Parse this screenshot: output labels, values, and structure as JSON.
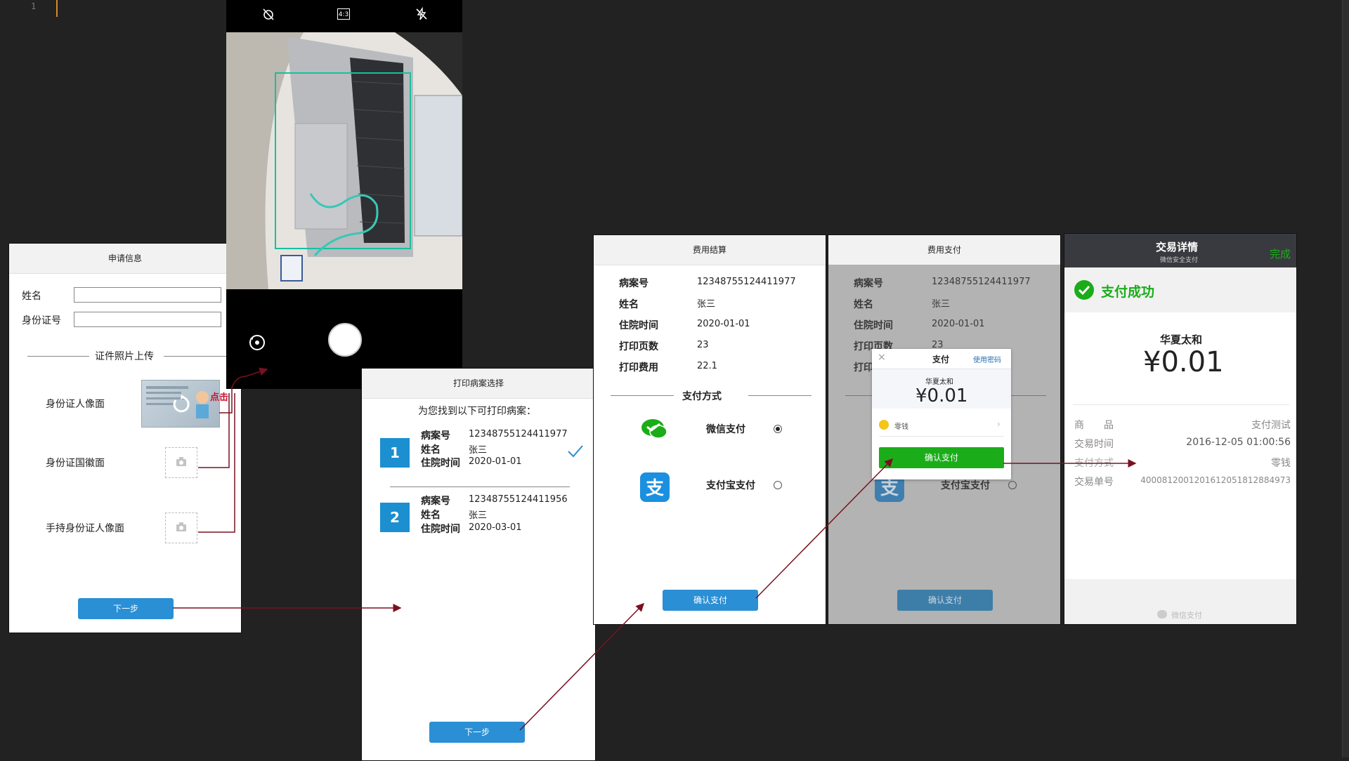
{
  "editor": {
    "line_number": "1"
  },
  "screen1": {
    "title": "申请信息",
    "name_label": "姓名",
    "id_label": "身份证号",
    "section_title": "证件照片上传",
    "front_label": "身份证人像面",
    "back_label": "身份证国徽面",
    "hand_label": "手持身份证人像面",
    "click_hint": "点击",
    "next_button": "下一步"
  },
  "camera": {
    "top_icons": [
      "timer-off-icon",
      "aspect-ratio-icon",
      "flash-off-icon"
    ],
    "ratio_label": "4:3"
  },
  "screen3": {
    "title": "打印病案选择",
    "subtitle": "为您找到以下可打印病案：",
    "records": [
      {
        "number": "1",
        "case_label": "病案号",
        "case_no": "12348755124411977",
        "name_label": "姓名",
        "name": "张三",
        "date_label": "住院时间",
        "date": "2020-01-01",
        "selected": true
      },
      {
        "number": "2",
        "case_label": "病案号",
        "case_no": "12348755124411956",
        "name_label": "姓名",
        "name": "张三",
        "date_label": "住院时间",
        "date": "2020-03-01",
        "selected": false
      }
    ],
    "next_button": "下一步"
  },
  "screen4": {
    "title": "费用结算",
    "fields": [
      {
        "label": "病案号",
        "value": "12348755124411977"
      },
      {
        "label": "姓名",
        "value": "张三"
      },
      {
        "label": "住院时间",
        "value": "2020-01-01"
      },
      {
        "label": "打印页数",
        "value": "23"
      },
      {
        "label": "打印费用",
        "value": "22.1"
      }
    ],
    "pay_method_title": "支付方式",
    "wechat_label": "微信支付",
    "alipay_label": "支付宝支付",
    "confirm_button": "确认支付"
  },
  "screen5": {
    "title": "费用支付",
    "fields": [
      {
        "label": "病案号",
        "value": "12348755124411977"
      },
      {
        "label": "姓名",
        "value": "张三"
      },
      {
        "label": "住院时间",
        "value": "2020-01-01"
      },
      {
        "label": "打印页数",
        "value": "23"
      },
      {
        "label": "打印",
        "value": ""
      }
    ],
    "alipay_label": "支付宝支付",
    "confirm_button": "确认支付",
    "dialog": {
      "title": "支付",
      "use_password": "使用密码",
      "merchant": "华夏太和",
      "amount": "¥0.01",
      "balance_label": "零钱",
      "confirm": "确认支付"
    }
  },
  "screen6": {
    "title": "交易详情",
    "subtitle": "微信安全支付",
    "done": "完成",
    "success": "支付成功",
    "merchant": "华夏太和",
    "amount": "¥0.01",
    "rows": [
      {
        "label": "商　　品",
        "value": "支付测试"
      },
      {
        "label": "交易时间",
        "value": "2016-12-05 01:00:56"
      },
      {
        "label": "支付方式",
        "value": "零钱"
      },
      {
        "label": "交易单号",
        "value": "4000812001201612051812884973"
      }
    ],
    "footer": "微信支付"
  },
  "colors": {
    "accent": "#2a8fd4",
    "wechat_green": "#1aad19",
    "arrow": "#7a1020",
    "record_badge": "#1b8fd0"
  }
}
